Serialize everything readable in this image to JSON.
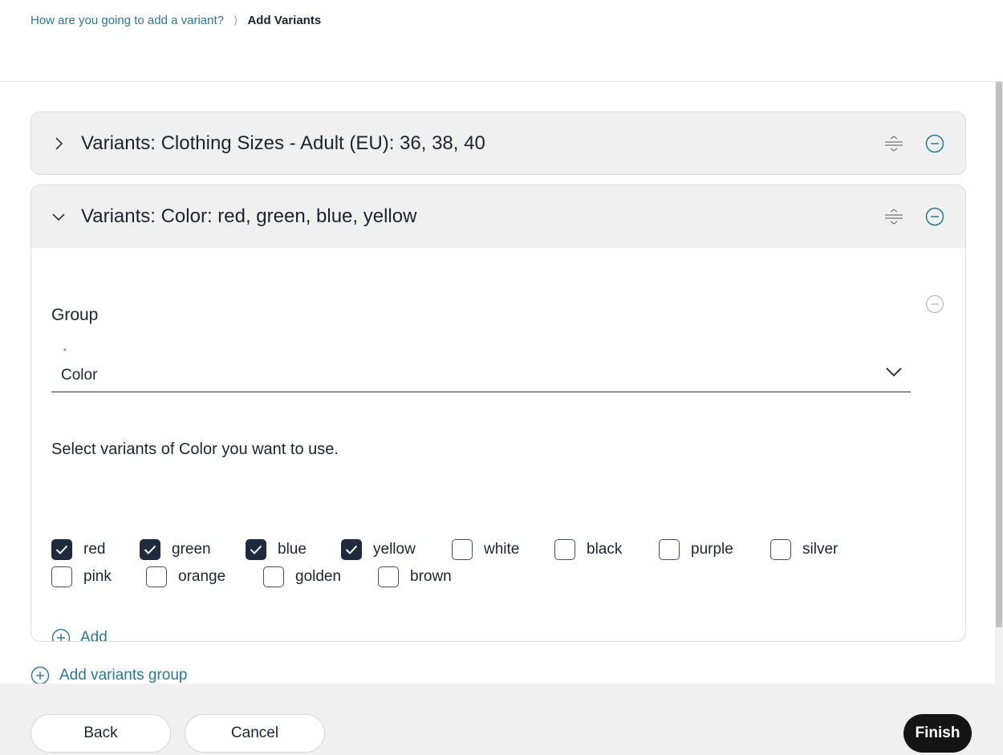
{
  "breadcrumb": {
    "link": "How are you going to add a variant?",
    "separator": "⟩",
    "current": "Add Variants"
  },
  "panels": [
    {
      "title": "Variants: Clothing Sizes - Adult (EU): 36, 38, 40",
      "expanded": false
    },
    {
      "title": "Variants: Color: red, green, blue, yellow",
      "expanded": true,
      "group": {
        "label": "Group",
        "required_mark": "*",
        "selected": "Color",
        "prompt": "Select variants of Color you want to use.",
        "options": [
          {
            "label": "red",
            "checked": true
          },
          {
            "label": "green",
            "checked": true
          },
          {
            "label": "blue",
            "checked": true
          },
          {
            "label": "yellow",
            "checked": true
          },
          {
            "label": "white",
            "checked": false
          },
          {
            "label": "black",
            "checked": false
          },
          {
            "label": "purple",
            "checked": false
          },
          {
            "label": "silver",
            "checked": false
          },
          {
            "label": "pink",
            "checked": false
          },
          {
            "label": "orange",
            "checked": false
          },
          {
            "label": "golden",
            "checked": false
          },
          {
            "label": "brown",
            "checked": false
          }
        ],
        "add_label": "Add"
      }
    }
  ],
  "add_group_label": "Add variants group",
  "footer": {
    "back": "Back",
    "cancel": "Cancel",
    "finish": "Finish"
  },
  "colors": {
    "accent": "#2a7896",
    "checked": "#1f2a3c",
    "primary_button": "#141414"
  },
  "icons": [
    "chevron-right-icon",
    "chevron-down-icon",
    "drag-handle-icon",
    "minus-circle-icon",
    "plus-circle-icon"
  ]
}
